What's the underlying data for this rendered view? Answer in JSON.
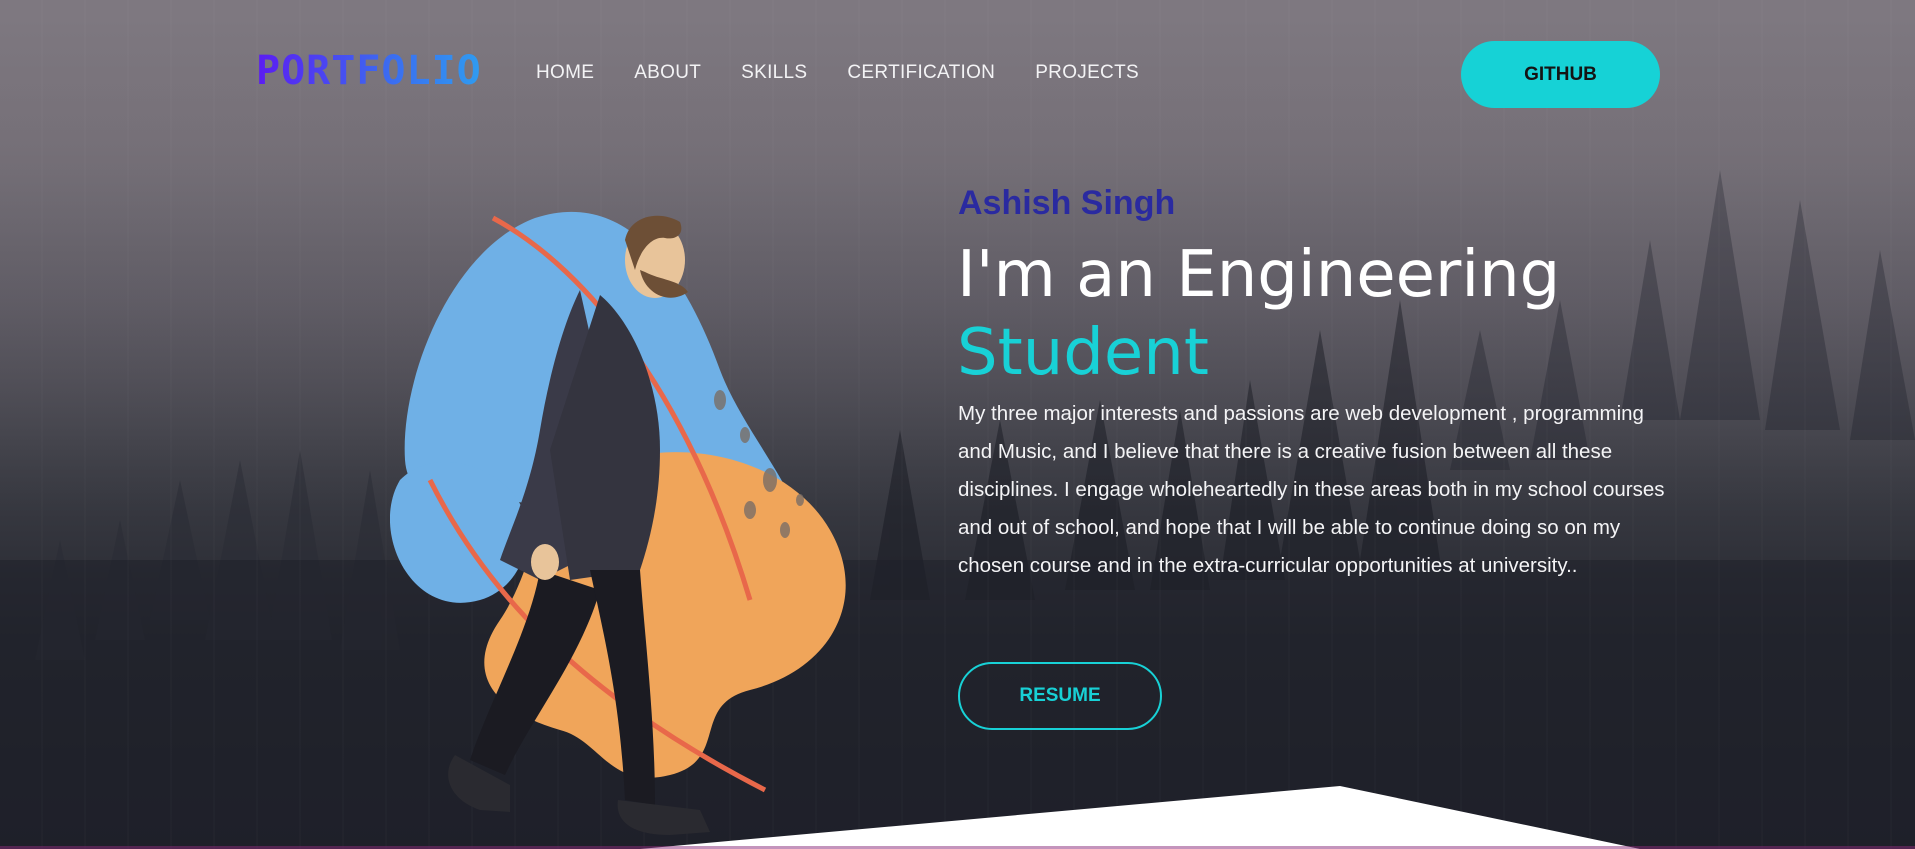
{
  "nav": {
    "logo": "PORTFOLIO",
    "items": [
      {
        "label": "HOME"
      },
      {
        "label": "ABOUT"
      },
      {
        "label": "SKILLS"
      },
      {
        "label": "CERTIFICATION"
      },
      {
        "label": "PROJECTS"
      }
    ],
    "github_label": "GITHUB"
  },
  "hero": {
    "name": "Ashish Singh",
    "title_line1": "I'm an Engineering",
    "title_accent": "Student",
    "description": "My three major interests and passions are web development , programming and Music, and I believe that there is a creative fusion between all these disciplines. I engage wholeheartedly in these areas both in my school courses and out of school, and hope that I will be able to continue doing so on my chosen course and in the extra-curricular opportunities at university..",
    "resume_label": "RESUME"
  },
  "colors": {
    "accent": "#18d1d6",
    "name": "#2a2aa0",
    "blob_blue": "#6fb0e6",
    "blob_orange": "#f0a55a"
  },
  "illustration": {
    "icon": "walking-man-illustration"
  }
}
